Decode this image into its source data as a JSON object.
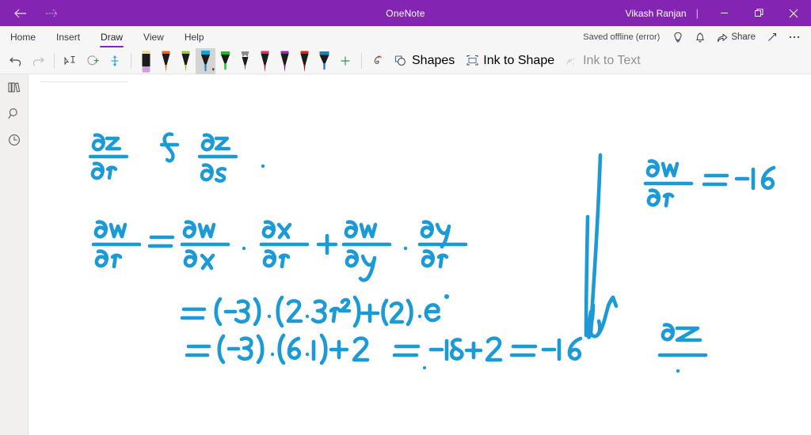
{
  "window": {
    "app_title": "OneNote",
    "user_name": "Vikash Ranjan",
    "back_icon": "back-arrow-icon",
    "forward_icon": "forward-arrow-icon",
    "minimize_label": "–",
    "restore_label": "❐",
    "close_label": "✕",
    "titlebar_color": "#8324b3"
  },
  "ribbon": {
    "tabs": [
      {
        "label": "Home",
        "active": false
      },
      {
        "label": "Insert",
        "active": false
      },
      {
        "label": "Draw",
        "active": true
      },
      {
        "label": "View",
        "active": false
      },
      {
        "label": "Help",
        "active": false
      }
    ],
    "status_text": "Saved offline (error)",
    "tell_me_icon": "lightbulb-icon",
    "notifications_icon": "bell-icon",
    "share_label": "Share",
    "share_icon": "share-icon",
    "expand_icon": "diagonal-arrow-icon",
    "more_icon": "ellipsis-icon",
    "accent_color": "#8324b3"
  },
  "tools": {
    "undo_label": "Undo",
    "undo_icon": "undo-arrow-icon",
    "redo_label": "Redo",
    "redo_icon": "redo-arrow-icon",
    "lasso_label": "Lasso Select",
    "lasso_icon": "lasso-select-icon",
    "eraser_label": "Eraser",
    "eraser_icon": "eraser-circle-icon",
    "space_label": "Insert Space",
    "space_icon": "insert-space-icon",
    "add_pen_label": "Add Pen",
    "add_pen_icon": "plus-icon",
    "ink_color_label": "Ink Color",
    "ink_color_icon": "ink-replay-icon",
    "shapes_label": "Shapes",
    "shapes_icon": "shapes-icon",
    "ink_to_shape_label": "Ink to Shape",
    "ink_to_shape_icon": "ink-to-shape-icon",
    "ink_to_text_label": "Ink to Text",
    "ink_to_text_icon": "ink-to-text-icon",
    "ink_to_text_disabled": true,
    "pens": [
      {
        "name": "highlighter-lavender",
        "type": "highlighter",
        "barrel": "#1b1b1b",
        "tip": "#c9a3d6",
        "cap": "#ecd9a0",
        "selected": false
      },
      {
        "name": "pen-orange",
        "type": "pen",
        "barrel": "#1b1b1b",
        "tip": "#e06c16",
        "cap": "#e06c16",
        "selected": false
      },
      {
        "name": "pen-yellow-green",
        "type": "pen",
        "barrel": "#1b1b1b",
        "tip": "#9ac926",
        "cap": "#9ac926",
        "selected": false
      },
      {
        "name": "pen-cyan",
        "type": "pen",
        "barrel": "#1b1b1b",
        "tip": "#0e8ecd",
        "cap": "#16a0e0",
        "selected": true
      },
      {
        "name": "highlighter-green",
        "type": "highlighter",
        "barrel": "#1b1b1b",
        "tip": "#14c414",
        "cap": "#14c414",
        "selected": false
      },
      {
        "name": "pencil-gray",
        "type": "pencil",
        "barrel": "#1b1b1b",
        "tip": "#6e6e6e",
        "cap": "#8a8a8a",
        "selected": false
      },
      {
        "name": "pen-pink",
        "type": "pen",
        "barrel": "#1b1b1b",
        "tip": "#a31b4b",
        "cap": "#e8276f",
        "selected": false
      },
      {
        "name": "pen-purple",
        "type": "pen",
        "barrel": "#1b1b1b",
        "tip": "#7a1a8c",
        "cap": "#a61fbd",
        "selected": false
      },
      {
        "name": "pen-red",
        "type": "pen",
        "barrel": "#1b1b1b",
        "tip": "#9e1414",
        "cap": "#e02314",
        "selected": false
      },
      {
        "name": "highlighter-blue",
        "type": "highlighter",
        "barrel": "#1b1b1b",
        "tip": "#1f7fb8",
        "cap": "#1f7fb8",
        "selected": false
      }
    ]
  },
  "sidebar": {
    "items": [
      {
        "label": "Notebooks",
        "icon": "notebooks-icon"
      },
      {
        "label": "Search",
        "icon": "search-icon"
      },
      {
        "label": "Recent Notes",
        "icon": "clock-icon"
      }
    ]
  },
  "page": {
    "ink_color": "#1c9ad6",
    "title_placeholder": "",
    "notes": [
      {
        "name": "heading-partials",
        "text": "∂z/∂r  &  ∂z/∂s ."
      },
      {
        "name": "chain-rule-line",
        "text": "∂w/∂r = ∂w/∂x · ∂x/∂r + ∂w/∂y · ∂y/∂r"
      },
      {
        "name": "substitution-line",
        "text": "= (−3)·(2·3r²) + (2)·e"
      },
      {
        "name": "evaluation-line",
        "text": "= (−3)·(6·1) + 2  =  −18+2 = −16"
      },
      {
        "name": "result-annotation",
        "text": "∂w/∂r = −16"
      },
      {
        "name": "next-step-annotation",
        "text": "∂z"
      }
    ]
  }
}
